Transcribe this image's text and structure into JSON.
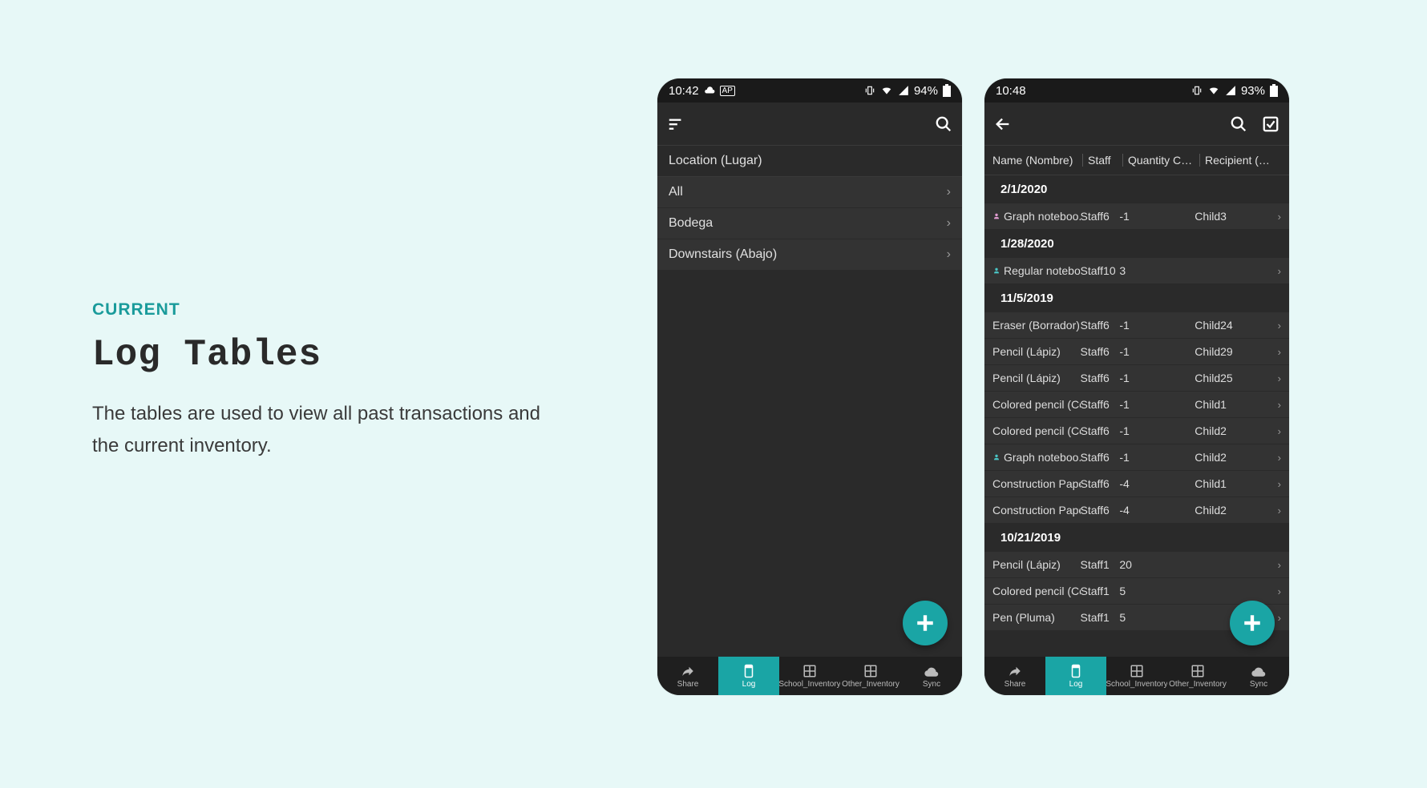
{
  "text": {
    "eyebrow": "CURRENT",
    "title": "Log Tables",
    "desc": "The tables are used to view all past transactions and the current inventory."
  },
  "phone1": {
    "status": {
      "time": "10:42",
      "battery": "94%"
    },
    "section_header": "Location (Lugar)",
    "locations": [
      "All",
      "Bodega",
      "Downstairs (Abajo)"
    ]
  },
  "phone2": {
    "status": {
      "time": "10:48",
      "battery": "93%"
    },
    "columns": [
      "Name (Nombre)",
      "Staff",
      "Quantity Cha...",
      "Recipient (Niño)"
    ],
    "groups": [
      {
        "date": "2/1/2020",
        "rows": [
          {
            "icon": "pink",
            "name": "Graph noteboo...",
            "staff": "Staff6",
            "qty": "-1",
            "recip": "Child3"
          }
        ]
      },
      {
        "date": "1/28/2020",
        "rows": [
          {
            "icon": "teal",
            "name": "Regular notebo...",
            "staff": "Staff10",
            "qty": "3",
            "recip": ""
          }
        ]
      },
      {
        "date": "11/5/2019",
        "rows": [
          {
            "icon": "",
            "name": "Eraser (Borrador)",
            "staff": "Staff6",
            "qty": "-1",
            "recip": "Child24"
          },
          {
            "icon": "",
            "name": "Pencil (Lápiz)",
            "staff": "Staff6",
            "qty": "-1",
            "recip": "Child29"
          },
          {
            "icon": "",
            "name": "Pencil (Lápiz)",
            "staff": "Staff6",
            "qty": "-1",
            "recip": "Child25"
          },
          {
            "icon": "",
            "name": "Colored pencil (Co...",
            "staff": "Staff6",
            "qty": "-1",
            "recip": "Child1"
          },
          {
            "icon": "",
            "name": "Colored pencil (Co...",
            "staff": "Staff6",
            "qty": "-1",
            "recip": "Child2"
          },
          {
            "icon": "teal",
            "name": "Graph noteboo...",
            "staff": "Staff6",
            "qty": "-1",
            "recip": "Child2"
          },
          {
            "icon": "",
            "name": "Construction Pape...",
            "staff": "Staff6",
            "qty": "-4",
            "recip": "Child1"
          },
          {
            "icon": "",
            "name": "Construction Pape...",
            "staff": "Staff6",
            "qty": "-4",
            "recip": "Child2"
          }
        ]
      },
      {
        "date": "10/21/2019",
        "rows": [
          {
            "icon": "",
            "name": "Pencil (Lápiz)",
            "staff": "Staff1",
            "qty": "20",
            "recip": ""
          },
          {
            "icon": "",
            "name": "Colored pencil (Co...",
            "staff": "Staff1",
            "qty": "5",
            "recip": ""
          },
          {
            "icon": "",
            "name": "Pen (Pluma)",
            "staff": "Staff1",
            "qty": "5",
            "recip": ""
          }
        ]
      }
    ]
  },
  "nav": {
    "items": [
      "Share",
      "Log",
      "School_Inventory",
      "Other_Inventory",
      "Sync"
    ]
  }
}
